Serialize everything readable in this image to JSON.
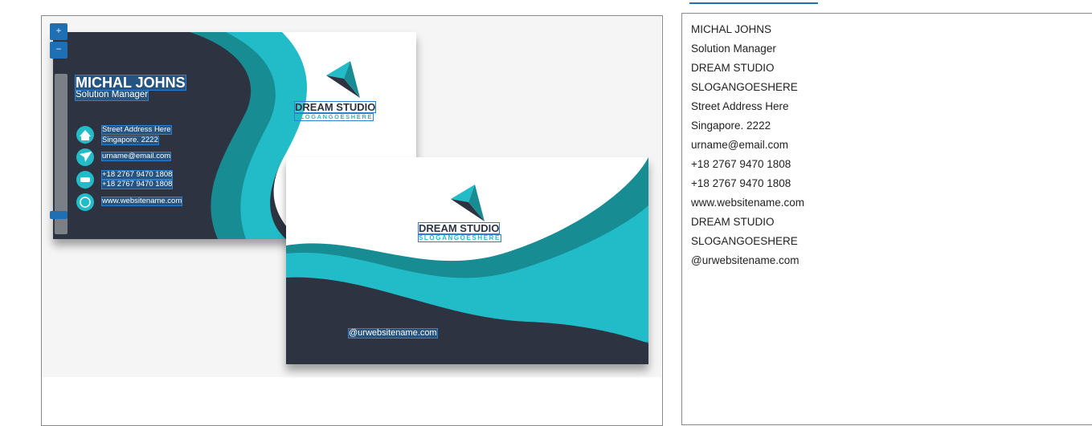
{
  "front_card": {
    "name": "MICHAL JOHNS",
    "title": "Solution Manager",
    "address_line1": "Street Address Here",
    "address_line2": "Singapore. 2222",
    "email": "urname@email.com",
    "phone1": "+18 2767 9470 1808",
    "phone2": "+18 2767 9470 1808",
    "website": "www.websitename.com",
    "logo_name": "DREAM STUDIO",
    "logo_slogan": "SLOGANGOESHERE"
  },
  "back_card": {
    "logo_name": "DREAM STUDIO",
    "logo_slogan": "SLOGANGOESHERE",
    "social": "@urwebsitename.com"
  },
  "extracted_text": [
    "MICHAL JOHNS",
    "Solution Manager",
    "DREAM STUDIO",
    "SLOGANGOESHERE",
    "Street Address Here",
    "Singapore. 2222",
    "urname@email.com",
    "+18 2767 9470 1808",
    "+18 2767 9470 1808",
    "www.websitename.com",
    "DREAM STUDIO",
    "SLOGANGOESHERE",
    "@urwebsitename.com"
  ],
  "colors": {
    "teal": "#22bcc9",
    "dark_teal": "#178c93",
    "charcoal": "#2d3340",
    "accent": "#1f6fb5"
  }
}
